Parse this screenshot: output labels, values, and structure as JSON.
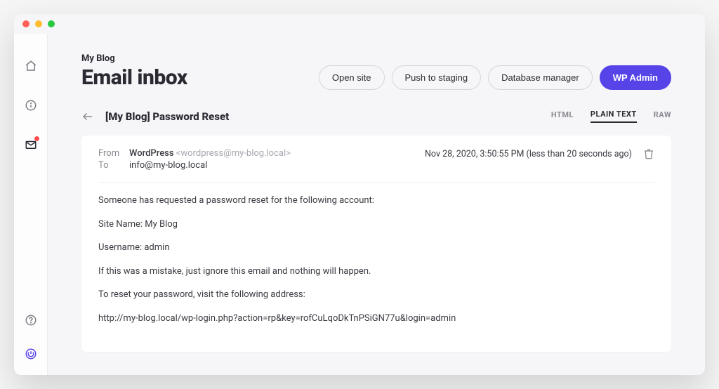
{
  "header": {
    "site_name": "My Blog",
    "page_title": "Email inbox",
    "actions": {
      "open_site": "Open site",
      "push_staging": "Push to staging",
      "db_manager": "Database manager",
      "wp_admin": "WP Admin"
    }
  },
  "email": {
    "subject": "[My Blog] Password Reset",
    "tabs": {
      "html": "HTML",
      "plain": "PLAIN TEXT",
      "raw": "RAW"
    },
    "from_label": "From",
    "to_label": "To",
    "from_name": "WordPress",
    "from_email": "<wordpress@my-blog.local>",
    "to_email": "info@my-blog.local",
    "timestamp": "Nov 28, 2020, 3:50:55 PM (less than 20 seconds ago)",
    "body": {
      "line1": "Someone has requested a password reset for the following account:",
      "line2": "Site Name: My Blog",
      "line3": "Username: admin",
      "line4": "If this was a mistake, just ignore this email and nothing will happen.",
      "line5": "To reset your password, visit the following address:",
      "line6": "http://my-blog.local/wp-login.php?action=rp&key=rofCuLqoDkTnPSiGN77u&login=admin"
    }
  }
}
